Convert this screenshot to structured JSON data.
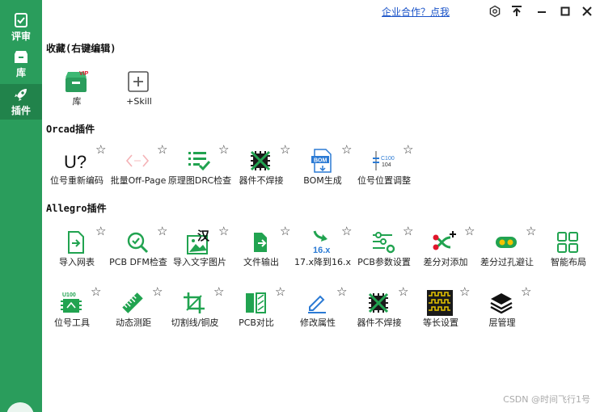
{
  "sidebar": {
    "items": [
      {
        "label": "评审",
        "icon": "review-icon"
      },
      {
        "label": "库",
        "icon": "library-icon"
      },
      {
        "label": "插件",
        "icon": "rocket-icon"
      }
    ]
  },
  "titlebar": {
    "coop_link": "企业合作？点我",
    "buttons": [
      "settings-icon",
      "pin-top-icon",
      "minimize-icon",
      "maximize-icon",
      "close-icon"
    ]
  },
  "favorites": {
    "title": "收藏(右键编辑)",
    "items": [
      {
        "label": "库",
        "icon": "library-box-icon"
      },
      {
        "label": "+Skill",
        "icon": "add-skill-icon"
      }
    ]
  },
  "orcad": {
    "title": "Orcad插件",
    "items": [
      {
        "label": "位号重新编码",
        "icon": "renumber-icon"
      },
      {
        "label": "批量Off-Page",
        "icon": "offpage-icon"
      },
      {
        "label": "原理图DRC检查",
        "icon": "drc-check-icon"
      },
      {
        "label": "器件不焊接",
        "icon": "no-solder-icon"
      },
      {
        "label": "BOM生成",
        "icon": "bom-icon"
      },
      {
        "label": "位号位置调整",
        "icon": "refdes-position-icon"
      }
    ]
  },
  "allegro": {
    "title": "Allegro插件",
    "row1": [
      {
        "label": "导入网表",
        "icon": "import-netlist-icon"
      },
      {
        "label": "PCB DFM检查",
        "icon": "dfm-check-icon"
      },
      {
        "label": "导入文字图片",
        "icon": "import-text-image-icon"
      },
      {
        "label": "文件输出",
        "icon": "file-output-icon"
      },
      {
        "label": "17.x降到16.x",
        "icon": "downgrade-icon"
      },
      {
        "label": "PCB参数设置",
        "icon": "pcb-params-icon"
      },
      {
        "label": "差分对添加",
        "icon": "diff-pair-add-icon"
      },
      {
        "label": "差分过孔避让",
        "icon": "diff-via-icon"
      },
      {
        "label": "智能布局",
        "icon": "smart-layout-icon"
      }
    ],
    "row2": [
      {
        "label": "位号工具",
        "icon": "refdes-tool-icon"
      },
      {
        "label": "动态测距",
        "icon": "measure-icon"
      },
      {
        "label": "切割线/铜皮",
        "icon": "cut-copper-icon"
      },
      {
        "label": "PCB对比",
        "icon": "pcb-compare-icon"
      },
      {
        "label": "修改属性",
        "icon": "edit-property-icon"
      },
      {
        "label": "器件不焊接",
        "icon": "no-solder-icon"
      },
      {
        "label": "等长设置",
        "icon": "length-match-icon"
      },
      {
        "label": "层管理",
        "icon": "layers-icon"
      }
    ]
  },
  "star_glyph": "☆",
  "watermark": "CSDN @时间飞行1号",
  "colors": {
    "sidebar": "#2a9d5c",
    "accent": "#21a350",
    "link": "#1a53c8"
  }
}
